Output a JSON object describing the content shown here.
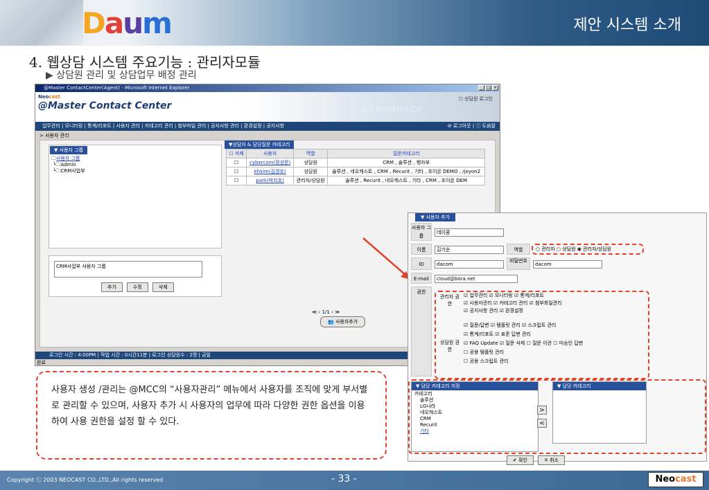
{
  "header": {
    "logo": [
      "D",
      "a",
      "u",
      "m"
    ],
    "title": "제안 시스템 소개"
  },
  "heading": "4. 웹상담 시스템 주요기능 : 관리자모듈",
  "subheading": "▶ 상담원 관리 및 상담업무 배정 관리",
  "browser": {
    "title": "@Master ContactCenter(Agent) - Microsoft Internet Explorer",
    "done": "완료"
  },
  "mcc": {
    "brand_a": "Neo",
    "brand_b": "cast",
    "title": "@Master  Contact  Center",
    "watermark": "administrator",
    "agent_login": "상담원 로그인",
    "menu": "업무관리 | 모니터링 | 통계/리포트 | 사용자 관리 | 카테고리 관리 | 첨부파일 관리 | 공지사항 관리 | 환경설정 | 공지사항",
    "logout": "로그아웃",
    "help": "도움말",
    "breadcrumb": "> 사용자 관리",
    "group_tab": "▼ 사용자 그룹",
    "tree": [
      "사용자 그룹",
      "Admin",
      "CRM사업부"
    ],
    "group_text": "CRM사업부 사용자 그룹",
    "group_btns": [
      "추가",
      "수정",
      "삭제"
    ],
    "cat_tab": "▼상담자 & 담당질문 카테고리",
    "cols": [
      "삭제",
      "사용자",
      "역할",
      "질문카테고리"
    ],
    "rows": [
      {
        "user": "cybercom(정성문)",
        "role": "상담원",
        "cat": "CRM , 솔루션 , 행자부"
      },
      {
        "user": "khkim(김경호)",
        "role": "상담원",
        "cat": "솔루션 , 네오캐스트 , CRM , Recurit , 기타 , 조이온 DEMO , /joyon2"
      },
      {
        "user": "park(박지호)",
        "role": "관리자/상담원",
        "cat": "솔루션 , Recurit , 네오캐스트 , 기타 , CRM , 조이온 DEM"
      }
    ],
    "pager": "≪ ‹ 1/1 › ≫",
    "add_user": "사용자추가",
    "status": "로그인 시간 : 4:00PM     |     작업 시간 : 0시간11분     |     로그인 상담원수 : 2명     |     금일"
  },
  "dialog": {
    "tab": "사용자 추가",
    "group_label": "사용자 그룹",
    "group_val": "데이콤",
    "name_label": "이름",
    "name_val": "김기순",
    "role_label": "역할",
    "roles": "○ 관리자  ○ 상담원  ◉ 관리자/상담원",
    "id_label": "ID",
    "id_val": "dacom",
    "pw_label": "비밀번호",
    "pw_val": "dacom",
    "email_label": "E-mail",
    "email_val": "cloud@bora.net",
    "perm_label": "권한",
    "admin_perm_label": "관리자 권한",
    "admin_perms": [
      "☑ 업무관리 ☑ 모니터링 ☑ 통계/리포트",
      "☑ 사용자관리 ☑ 카테고리 관리 ☑ 첨부화일관리",
      "☑ 공지사항 관리 ☑ 환경설정"
    ],
    "agent_perm_label": "상담원 권한",
    "agent_perms": [
      "☑ 질문/답변 ☑ 템플릿 관리 ☑ 스크립트 관리",
      "☑ 통계/리포트 ☑ 표준 답변 관리",
      "☑ FAQ Update ☑ 질문 삭제 ☐ 질문 이관 ☐ 미승인 답변",
      "☐ 공용 템플릿 관리",
      "☐ 공용 스크립트 관리"
    ],
    "assign_tab": "▼ 담당 카테고리 지정",
    "assigned_tab": "▼ 담당 카테고리",
    "cats": [
      "카테고리",
      "솔루션",
      "LG나라",
      "네오캐스트",
      "CRM",
      "Recurit",
      "기타"
    ],
    "ok": "✔ 확인",
    "cancel": "✕ 취소"
  },
  "description": "사용자 생성 /관리는 @MCC의 “사용자관리” 메뉴에서 사용자를 조직에 맞게 부서별로 관리할 수 있으며, 사용자 추가 시 사용자의 업무에 따라 다양한 권한 옵션을 이용하여 사용 권한을 설정 할 수 있다.",
  "footer": {
    "copyright": "Copyright ⓒ 2003 NEOCAST CO.,LTD.,All rights reserved",
    "page": "- 33 -",
    "logo_a": "Neo",
    "logo_b": "cast"
  }
}
